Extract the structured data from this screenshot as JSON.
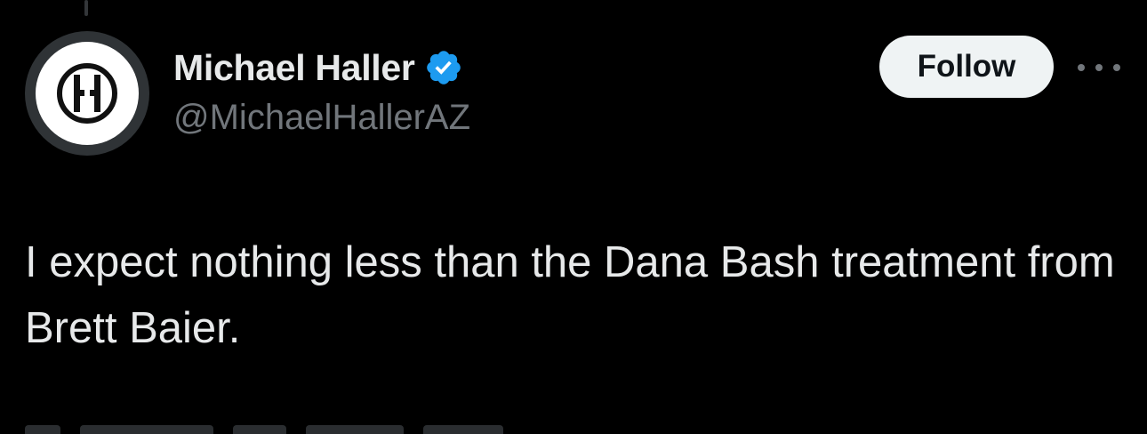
{
  "tweet": {
    "author": {
      "display_name": "Michael Haller",
      "handle": "@MichaelHallerAZ",
      "verified": true,
      "avatar_letter": "H"
    },
    "follow_label": "Follow",
    "text": "I expect nothing less than the Dana Bash treatment from Brett Baier."
  },
  "colors": {
    "background": "#000000",
    "text_primary": "#e7e9ea",
    "text_secondary": "#71767b",
    "verified_badge": "#1d9bf0",
    "follow_bg": "#eff3f4"
  },
  "icons": {
    "verified": "verified-badge-icon",
    "more": "more-dots-icon",
    "avatar_logo": "h-logo-icon"
  }
}
